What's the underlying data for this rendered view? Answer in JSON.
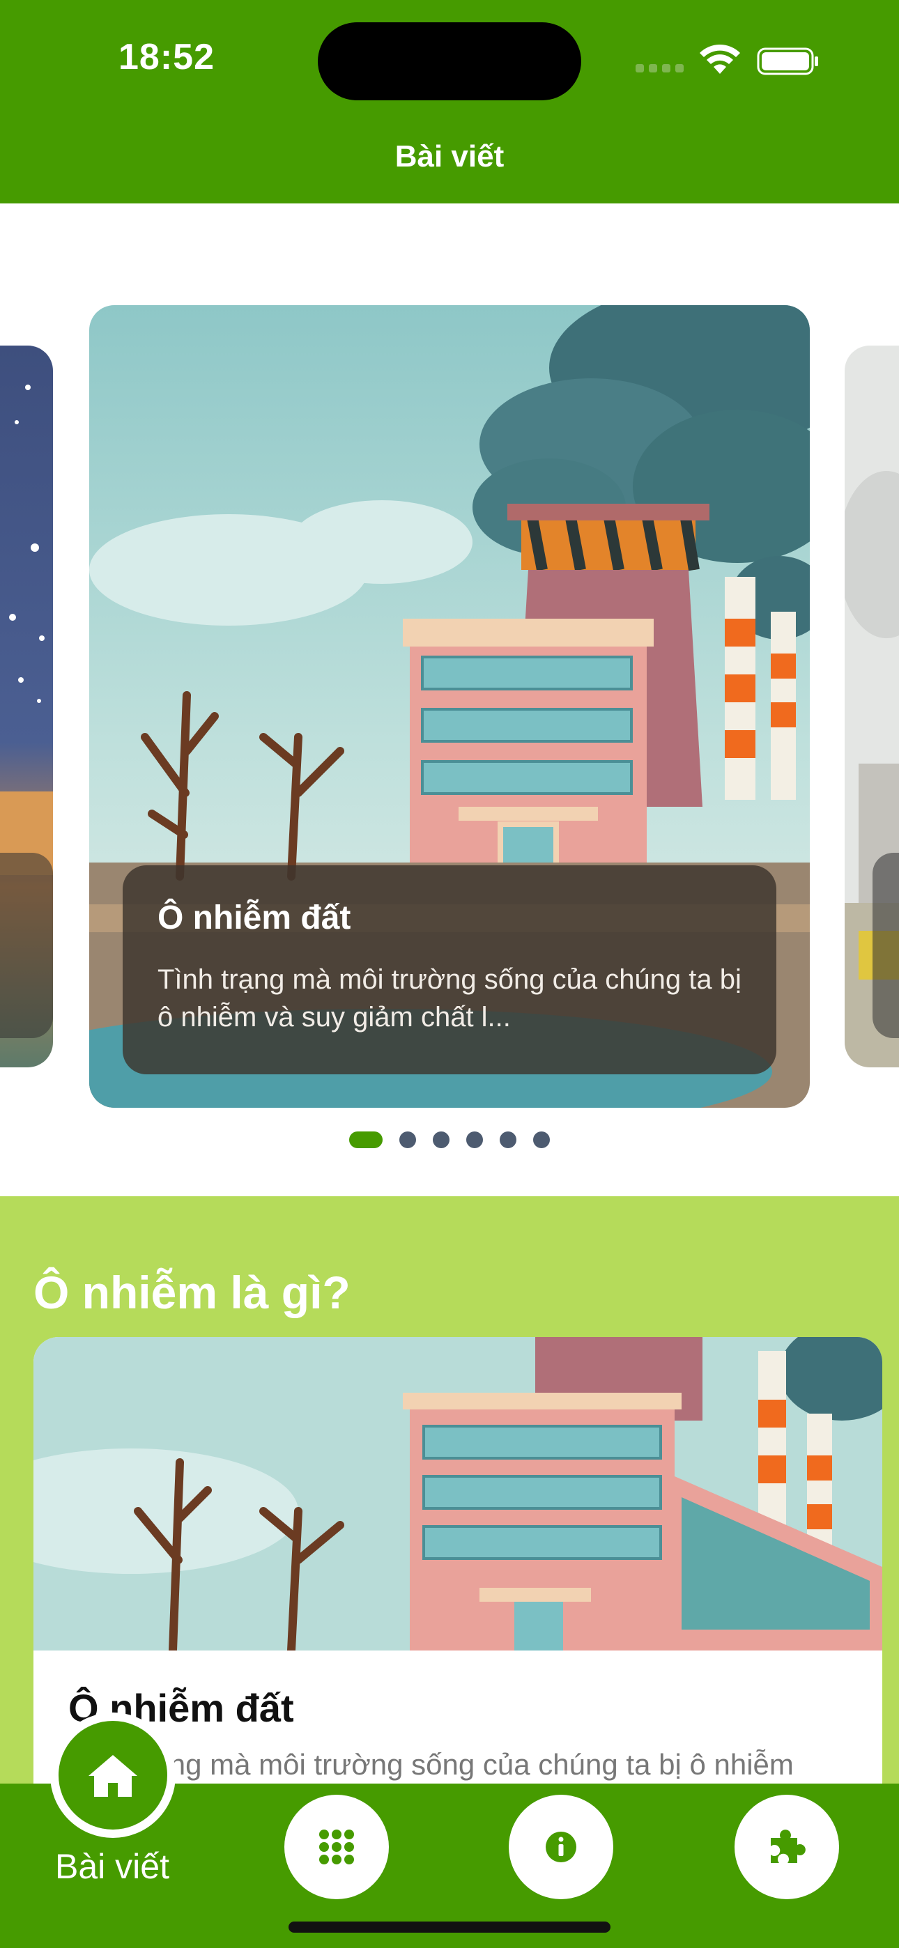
{
  "status_bar": {
    "time": "18:52"
  },
  "header": {
    "title": "Bài viết"
  },
  "carousel": {
    "cards": [
      {
        "title": "Ô nhiễm đất",
        "description": "Tình trạng mà môi trường sống của chúng ta bị ô nhiễm và suy giảm chất l..."
      }
    ],
    "active_index": 0,
    "page_count": 6
  },
  "section": {
    "title": "Ô nhiễm là gì?",
    "article": {
      "title": "Ô nhiễm đất",
      "description": "Tình trạng mà môi trường sống của chúng ta bị ô nhiễm"
    }
  },
  "tab_bar": {
    "active_label": "Bài viết",
    "tabs": [
      {
        "icon": "home-icon",
        "label": "Bài viết",
        "active": true
      },
      {
        "icon": "grid-icon",
        "label": "",
        "active": false
      },
      {
        "icon": "info-icon",
        "label": "",
        "active": false
      },
      {
        "icon": "puzzle-icon",
        "label": "",
        "active": false
      }
    ]
  },
  "colors": {
    "primary_green": "#469b00",
    "section_lime": "#b5db5a",
    "dot_inactive": "#4d5b70"
  }
}
